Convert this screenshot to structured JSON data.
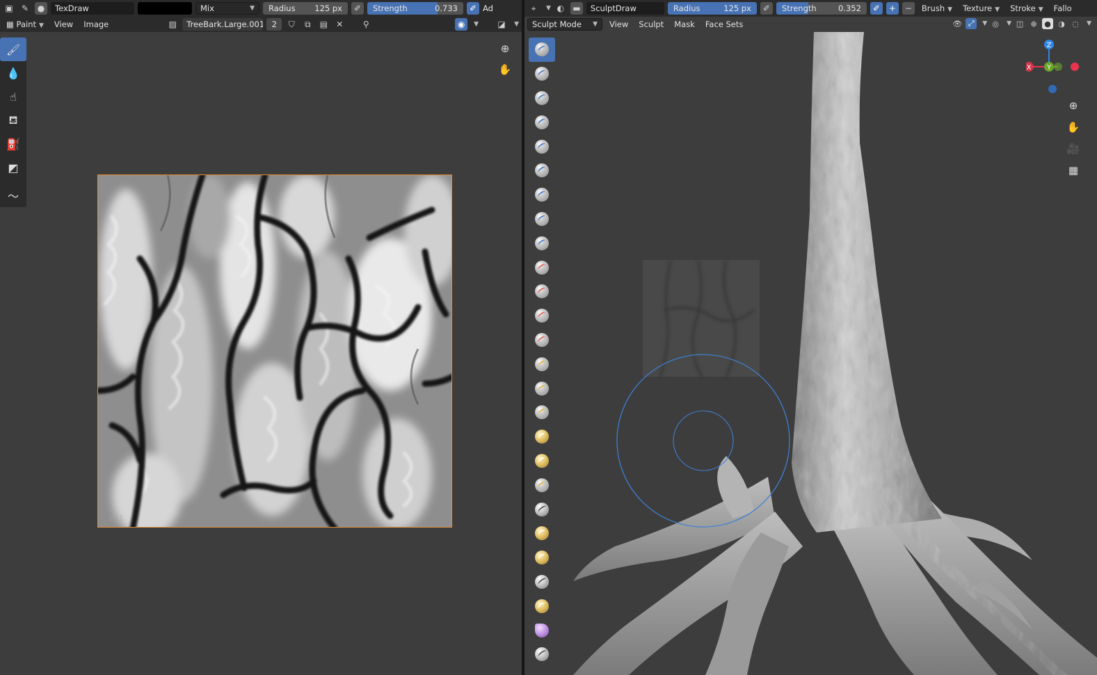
{
  "left_editor": {
    "header": {
      "brush_name": "TexDraw",
      "blend_mode": "Mix",
      "radius_label": "Radius",
      "radius_value": "125 px",
      "strength_label": "Strength",
      "strength_value": "0.733",
      "strength_fraction": 0.733,
      "add_label": "Ad",
      "color_hex": "#000000"
    },
    "menu": {
      "mode_label": "Paint",
      "view_label": "View",
      "image_label": "Image",
      "image_name": "TreeBark.Large.001",
      "users_count": "2"
    },
    "tile_label": "001",
    "tools": [
      "paintbrush-icon",
      "blur-drop-icon",
      "smear-icon",
      "clone-stamp-icon",
      "fill-bucket-icon",
      "mask-icon",
      "annotate-icon"
    ]
  },
  "right_editor": {
    "header": {
      "brush_name": "SculptDraw",
      "radius_label": "Radius",
      "radius_value": "125 px",
      "strength_label": "Strength",
      "strength_value": "0.352",
      "strength_fraction": 0.352,
      "brush_menu": "Brush",
      "texture_menu": "Texture",
      "stroke_menu": "Stroke",
      "falloff_menu": "Fallo"
    },
    "menu": {
      "mode_label": "Sculpt Mode",
      "view_label": "View",
      "sculpt_label": "Sculpt",
      "mask_label": "Mask",
      "face_sets_label": "Face Sets"
    },
    "gizmo": {
      "z_label": "Z",
      "y_label": "Y",
      "x_label": "X",
      "x_color": "#e8344c",
      "y_color": "#6aa62a",
      "z_color": "#2f87e6"
    },
    "brush_count": 26
  },
  "colors": {
    "accent": "#4772b3",
    "header_bg": "#2b2b2b",
    "editor_bg": "#3d3d3d",
    "image_border": "#e68c2e",
    "brush_circle": "#3f7fd0"
  }
}
